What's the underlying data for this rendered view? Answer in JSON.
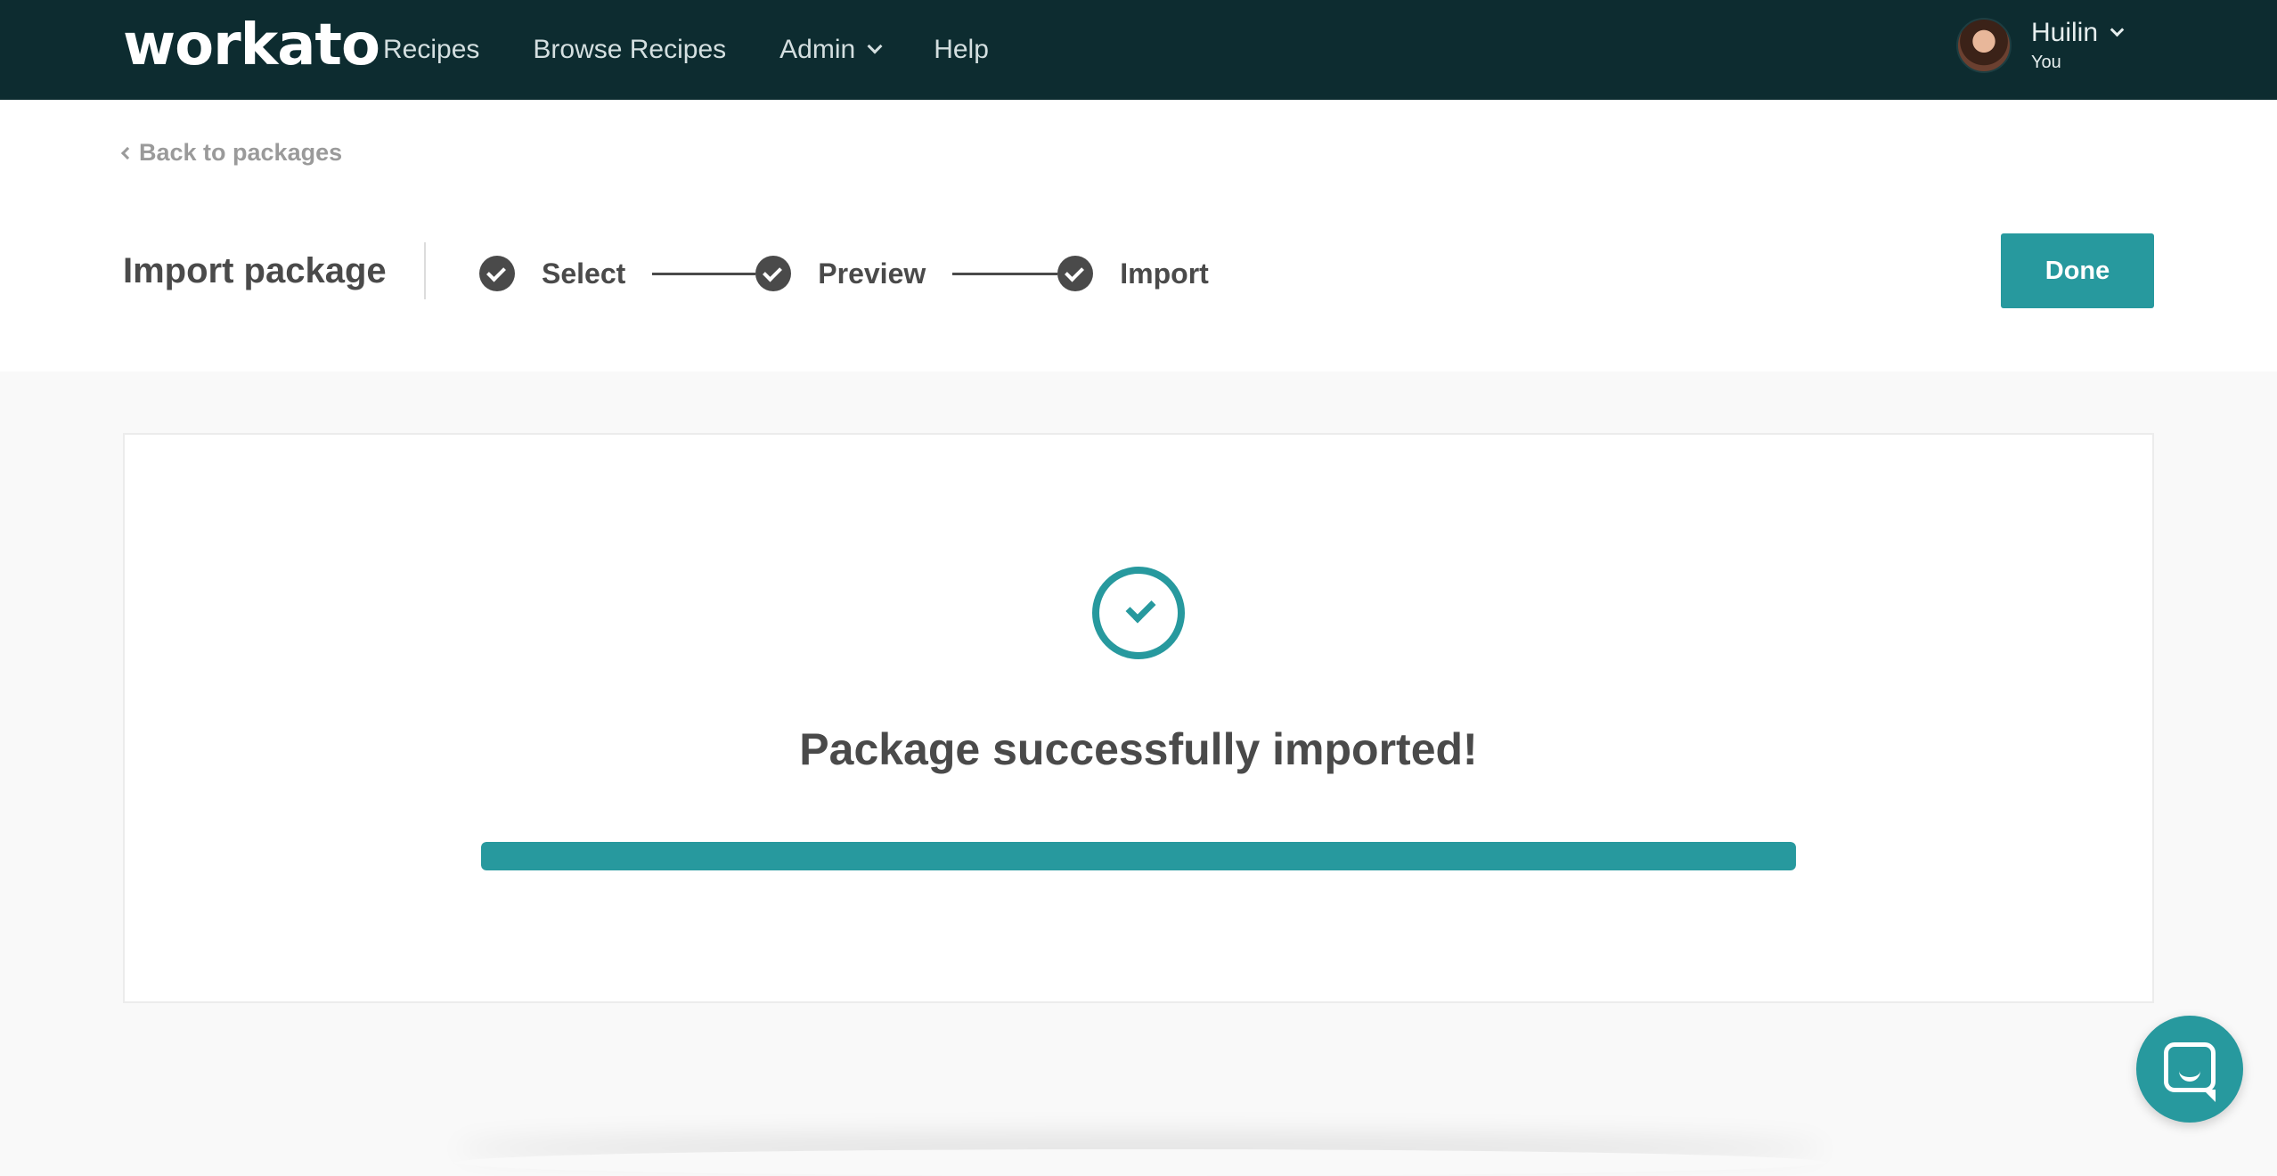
{
  "nav": {
    "logo": "workato",
    "items": [
      {
        "label": "Recipes"
      },
      {
        "label": "Browse Recipes"
      },
      {
        "label": "Admin",
        "has_dropdown": true
      },
      {
        "label": "Help"
      }
    ],
    "user": {
      "name": "Huilin",
      "subtitle": "You"
    }
  },
  "header": {
    "back_link": "Back to packages",
    "title": "Import package",
    "steps": [
      {
        "label": "Select",
        "status": "complete"
      },
      {
        "label": "Preview",
        "status": "complete"
      },
      {
        "label": "Import",
        "status": "complete"
      }
    ],
    "done_label": "Done"
  },
  "card": {
    "message": "Package successfully imported!",
    "progress_percent": 100
  },
  "colors": {
    "nav_bg": "#0d2c30",
    "accent": "#27999e",
    "text": "#4a4a4a",
    "page_bg": "#f9f9f9"
  },
  "icons": {
    "back": "chevron-left-icon",
    "step": "check-circle-icon",
    "success": "check-circle-outline-icon",
    "chat": "chat-bubble-icon"
  }
}
